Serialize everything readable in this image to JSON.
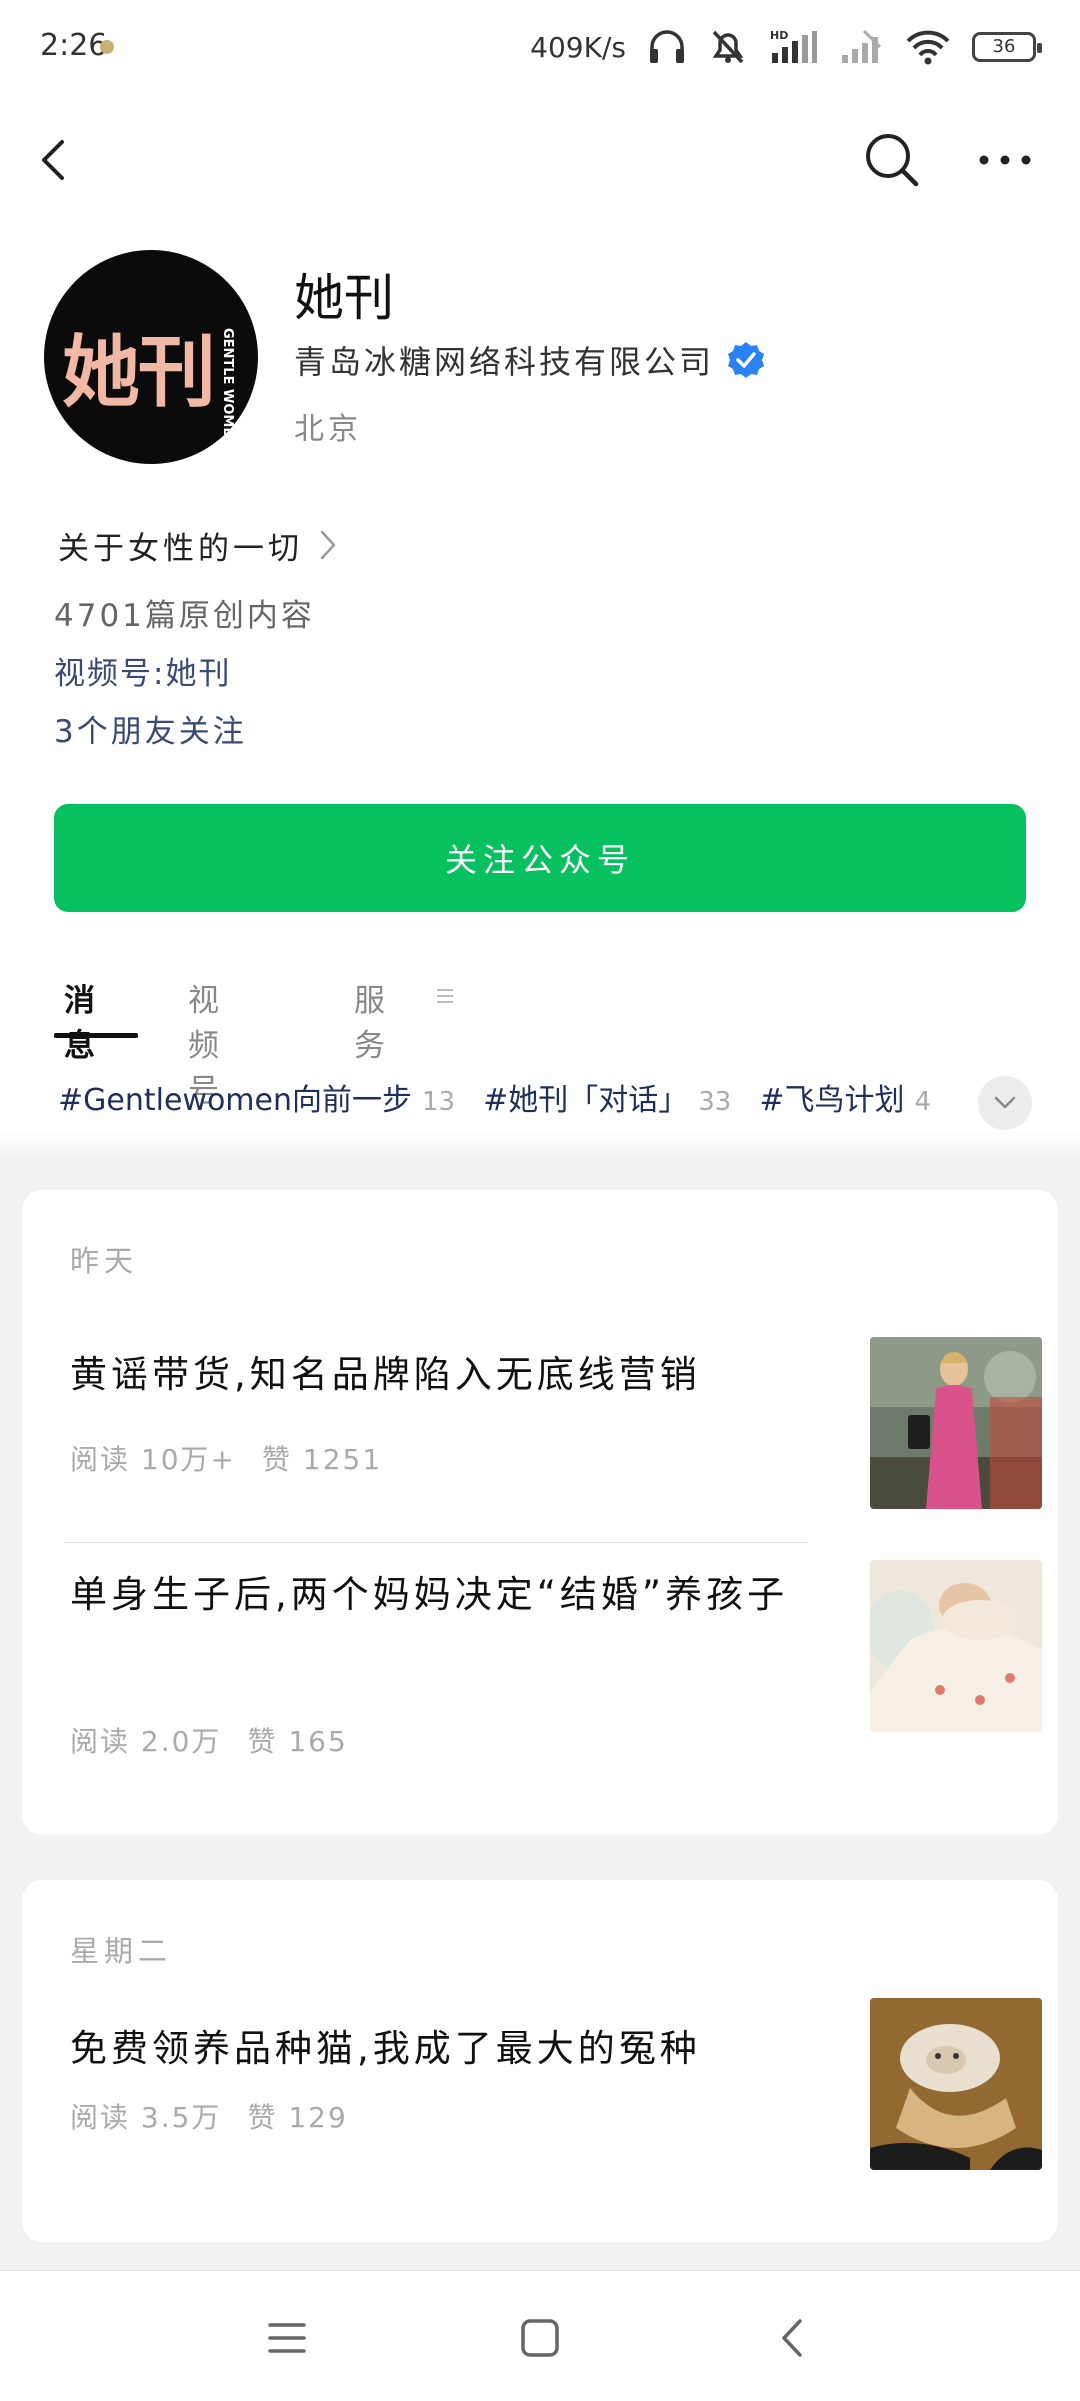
{
  "status_bar": {
    "time": "2:26",
    "network_speed": "409K/s",
    "battery": "36"
  },
  "profile": {
    "name": "她刊",
    "company": "青岛冰糖网络科技有限公司",
    "location": "北京",
    "logo_text": "她刊",
    "logo_sub": "GENTLE WOMEN",
    "intro": "关于女性的一切",
    "original_count": "4701篇原创内容",
    "video_account": "视频号:她刊",
    "friends_following": "3个朋友关注",
    "verified_color": "#2a83f5"
  },
  "follow_button": {
    "label": "关注公众号",
    "color": "#07c160"
  },
  "tabs": [
    {
      "label": "消息",
      "active": true
    },
    {
      "label": "视频号",
      "active": false
    },
    {
      "label": "服务",
      "active": false
    }
  ],
  "topics": [
    {
      "name": "#Gentlewomen向前一步",
      "count": "13"
    },
    {
      "name": "#她刊「对话」",
      "count": "33"
    },
    {
      "name": "#飞鸟计划",
      "count": "4"
    }
  ],
  "feed": [
    {
      "day": "昨天",
      "articles": [
        {
          "title": "黄谣带货,知名品牌陷入无底线营销",
          "reads": "阅读 10万+",
          "likes": "赞 1251"
        },
        {
          "title": "单身生子后,两个妈妈决定“结婚”养孩子",
          "reads": "阅读 2.0万",
          "likes": "赞 165"
        }
      ]
    },
    {
      "day": "星期二",
      "articles": [
        {
          "title": "免费领养品种猫,我成了最大的冤种",
          "reads": "阅读 3.5万",
          "likes": "赞 129"
        }
      ]
    }
  ],
  "icons": {
    "back": "chevron-left-icon",
    "search": "search-icon",
    "more": "more-horizontal-icon",
    "nav_menu": "menu-icon",
    "nav_home": "square-home-icon",
    "nav_back": "triangle-back-icon"
  }
}
